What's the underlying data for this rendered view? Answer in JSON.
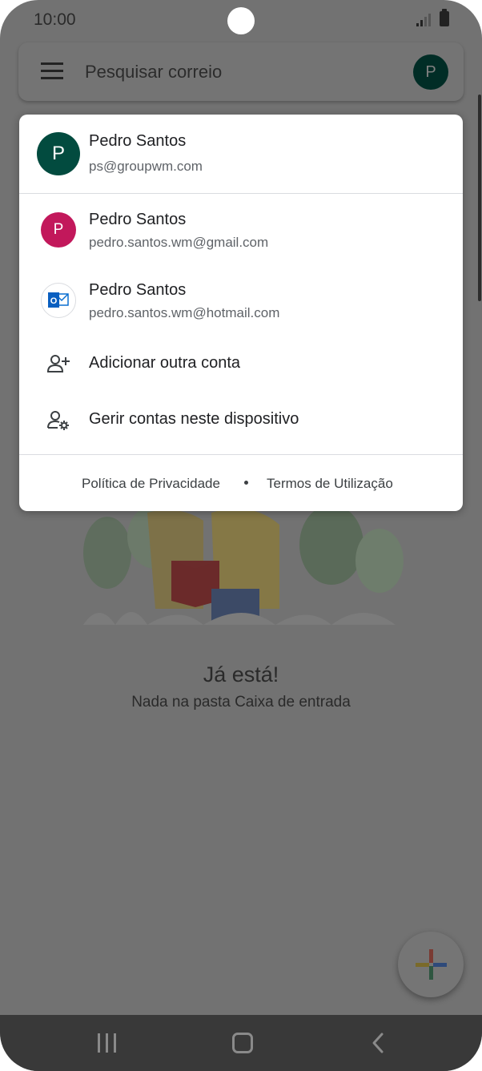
{
  "status_bar": {
    "time": "10:00"
  },
  "search_bar": {
    "placeholder": "Pesquisar correio",
    "avatar_letter": "P"
  },
  "empty_state": {
    "title": "Já está!",
    "subtitle": "Nada na pasta Caixa de entrada"
  },
  "account_sheet": {
    "current_account": {
      "name": "Pedro Santos",
      "email": "ps@groupwm.com",
      "avatar_letter": "P",
      "avatar_color": "#024b3f"
    },
    "other_accounts": [
      {
        "name": "Pedro Santos",
        "email": "pedro.santos.wm@gmail.com",
        "avatar_letter": "P",
        "avatar_color": "#c2185b"
      },
      {
        "name": "Pedro Santos",
        "email": "pedro.santos.wm@hotmail.com",
        "avatar_icon": "outlook-icon"
      }
    ],
    "actions": [
      {
        "label": "Adicionar outra conta",
        "icon": "add-person-icon"
      },
      {
        "label": "Gerir contas neste dispositivo",
        "icon": "manage-accounts-icon"
      }
    ],
    "footer": {
      "privacy": "Política de Privacidade",
      "terms": "Termos de Utilização"
    }
  }
}
